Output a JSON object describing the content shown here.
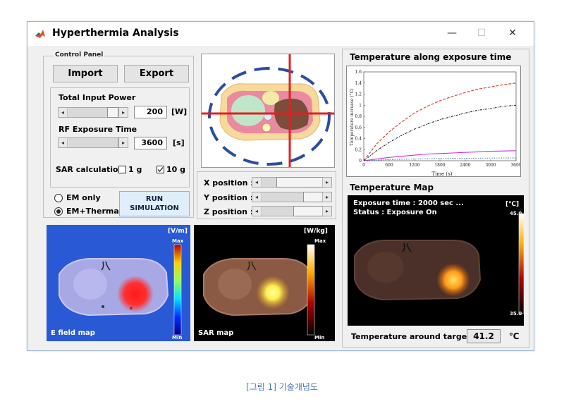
{
  "window": {
    "title": "Hyperthermia Analysis",
    "minimize": "—",
    "maximize": "☐",
    "close": "✕"
  },
  "control_panel": {
    "label": "Control Panel",
    "import_label": "Import",
    "export_label": "Export",
    "total_input_power": {
      "label": "Total Input Power",
      "value": "200",
      "unit": "[W]",
      "slider_fraction": 0.78
    },
    "rf_exposure_time": {
      "label": "RF Exposure Time",
      "value": "3600",
      "unit": "[s]",
      "slider_fraction": 0.98
    },
    "sar_calculation": {
      "label": "SAR calculation",
      "option_1g": "1 g",
      "option_10g": "10 g",
      "checked": "10 g"
    },
    "mode": {
      "option_em_only": "EM only",
      "option_em_thermal": "EM+Thermal",
      "selected": "EM+Thermal"
    },
    "run_label_line1": "RUN",
    "run_label_line2": "SIMULATION"
  },
  "position": {
    "x_label": "X position :",
    "y_label": "Y position :",
    "z_label": "Z position :"
  },
  "efield_map": {
    "label": "E field map",
    "unit": "[V/m]",
    "max": "Max",
    "min": "Min"
  },
  "sar_map": {
    "label": "SAR map",
    "unit": "[W/kg]",
    "max": "Max",
    "min": "Min"
  },
  "temperature_chart": {
    "title": "Temperature along exposure time",
    "chart_data": {
      "type": "line",
      "xlabel": "Time (s)",
      "ylabel": "Temperature increase (°C)",
      "xlim": [
        0,
        3600
      ],
      "ylim": [
        0,
        1.6
      ],
      "x_ticks": [
        "0",
        "600",
        "1200",
        "1800",
        "2400",
        "3000",
        "3600"
      ],
      "y_ticks": [
        "0",
        "0.2",
        "0.4",
        "0.6",
        "0.8",
        "1",
        "1.2",
        "1.4",
        "1.6"
      ],
      "x": [
        0,
        300,
        600,
        900,
        1200,
        1500,
        1800,
        2100,
        2400,
        2700,
        3000,
        3300,
        3600
      ],
      "series": [
        {
          "color": "#e03030",
          "style": "dashed",
          "values": [
            0,
            0.3,
            0.52,
            0.7,
            0.86,
            0.98,
            1.08,
            1.16,
            1.23,
            1.29,
            1.33,
            1.37,
            1.4
          ]
        },
        {
          "color": "#222222",
          "style": "dashdot",
          "values": [
            0,
            0.18,
            0.33,
            0.46,
            0.57,
            0.66,
            0.74,
            0.8,
            0.86,
            0.91,
            0.94,
            0.98,
            1.0
          ]
        },
        {
          "color": "#d030d0",
          "style": "solid",
          "values": [
            0,
            0.03,
            0.06,
            0.08,
            0.1,
            0.12,
            0.13,
            0.14,
            0.15,
            0.16,
            0.17,
            0.175,
            0.18
          ]
        },
        {
          "color": "#3060c0",
          "style": "dotted",
          "values": [
            0,
            0.01,
            0.02,
            0.025,
            0.03,
            0.035,
            0.04,
            0.042,
            0.044,
            0.046,
            0.048,
            0.05,
            0.05
          ]
        }
      ]
    }
  },
  "temperature_map": {
    "title": "Temperature Map",
    "exposure_text": "Exposure time : 2000 sec ...",
    "status_text": "Status : Exposure On",
    "unit": "[℃]",
    "max": "45.0",
    "min": "35.0"
  },
  "target": {
    "label": "Temperature around target",
    "value": "41.2",
    "unit": "℃"
  },
  "caption": "[그림 1] 기술개념도"
}
